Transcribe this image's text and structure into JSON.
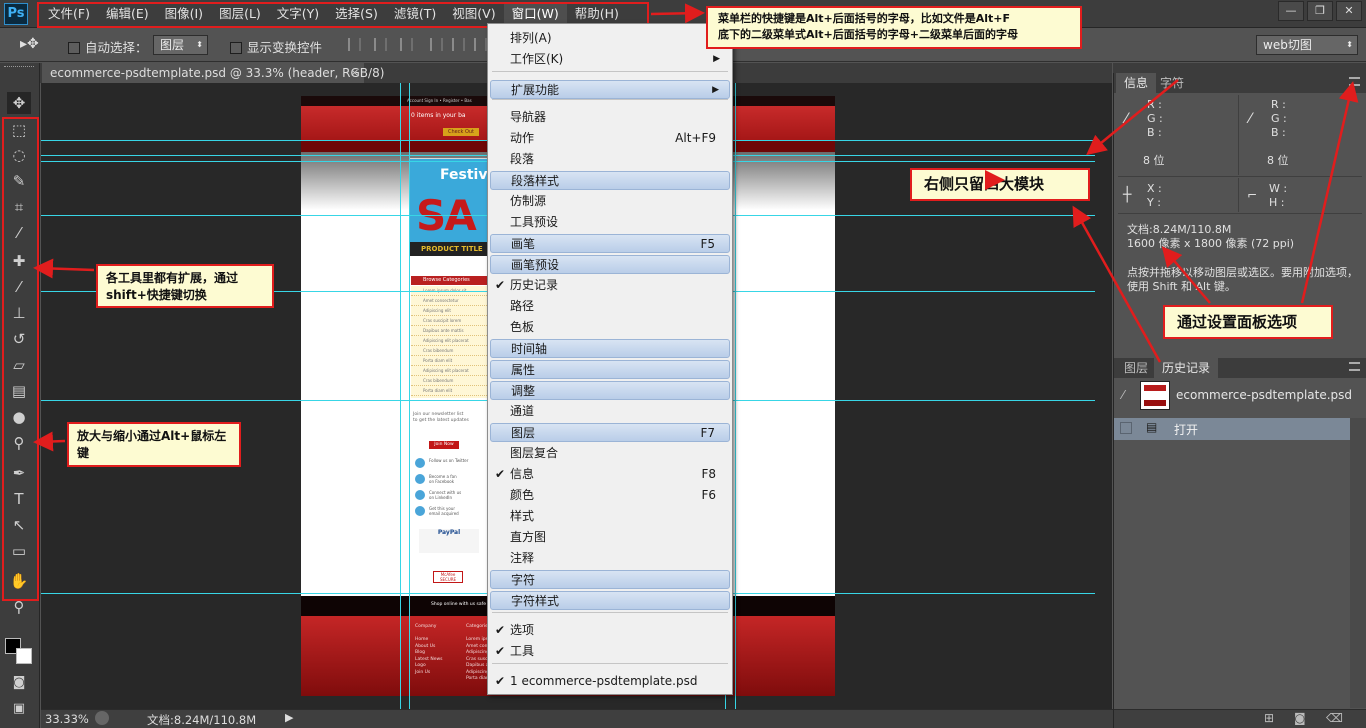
{
  "app": {
    "logo": "Ps"
  },
  "menubar": {
    "items": [
      "文件(F)",
      "编辑(E)",
      "图像(I)",
      "图层(L)",
      "文字(Y)",
      "选择(S)",
      "滤镜(T)",
      "视图(V)",
      "窗口(W)",
      "帮助(H)"
    ],
    "active_index": 8
  },
  "window_controls": [
    "—",
    "❐",
    "✕"
  ],
  "options": {
    "auto_select_label": "自动选择：",
    "auto_select_value": "图层",
    "show_transform_label": "显示变换控件",
    "workspace_value": "web切图"
  },
  "doc_tab": {
    "title": "ecommerce-psdtemplate.psd @ 33.3% (header, RGB/8)",
    "close": "×"
  },
  "window_menu": {
    "items": [
      {
        "label": "排列(A)",
        "arrow": true,
        "hl": false
      },
      {
        "label": "工作区(K)",
        "arrow": true,
        "hl": false
      },
      {
        "sep": true
      },
      {
        "label": "扩展功能",
        "arrow": true,
        "hl": true
      },
      {
        "sep": true
      },
      {
        "label": "导航器"
      },
      {
        "label": "动作",
        "shortcut": "Alt+F9"
      },
      {
        "label": "段落"
      },
      {
        "label": "段落样式",
        "hl": true
      },
      {
        "label": "仿制源"
      },
      {
        "label": "工具预设"
      },
      {
        "label": "画笔",
        "shortcut": "F5",
        "hl": true
      },
      {
        "label": "画笔预设",
        "hl": true
      },
      {
        "label": "历史记录",
        "checked": true
      },
      {
        "label": "路径"
      },
      {
        "label": "色板"
      },
      {
        "label": "时间轴",
        "hl": true
      },
      {
        "label": "属性",
        "hl": true
      },
      {
        "label": "调整",
        "hl": true
      },
      {
        "label": "通道"
      },
      {
        "label": "图层",
        "shortcut": "F7",
        "hl": true
      },
      {
        "label": "图层复合"
      },
      {
        "label": "信息",
        "shortcut": "F8",
        "checked": true
      },
      {
        "label": "颜色",
        "shortcut": "F6"
      },
      {
        "label": "样式"
      },
      {
        "label": "直方图"
      },
      {
        "label": "注释"
      },
      {
        "label": "字符",
        "hl": true
      },
      {
        "label": "字符样式",
        "hl": true
      },
      {
        "sep": true
      },
      {
        "label": "选项",
        "checked": true
      },
      {
        "label": "工具",
        "checked": true
      },
      {
        "sep": true
      },
      {
        "label": "1 ecommerce-psdtemplate.psd",
        "checked": true
      }
    ]
  },
  "info_panel": {
    "tabs": [
      "信息",
      "字符"
    ],
    "rgb_labels": "R :\nG :\nB :",
    "bits": "8 位",
    "xy_labels": "X :\nY :",
    "wh_labels": "W :\nH :",
    "doc_size": "文档:8.24M/110.8M",
    "dimensions": "1600 像素 x 1800 像素 (72 ppi)",
    "hint": "点按并拖移以移动图层或选区。要用附加选项，使用 Shift 和 Alt 键。"
  },
  "history_panel": {
    "tabs": [
      "图层",
      "历史记录"
    ],
    "snapshot_name": "ecommerce-psdtemplate.psd",
    "state": "打开"
  },
  "statusbar": {
    "zoom": "33.33%",
    "doc": "文档:8.24M/110.8M"
  },
  "annotations": {
    "menu_note": "菜单栏的快捷键是Alt+后面括号的字母，比如文件是Alt+F\n底下的二级菜单式Alt+后面括号的字母+二级菜单后面的字母",
    "tools_note": "各工具里都有扩展，通过shift+快捷键切换",
    "zoom_note": "放大与缩小通过Alt+鼠标左键",
    "right_note": "右侧只留四大模块",
    "panel_note": "通过设置面板选项"
  },
  "artboard": {
    "top_links": "Account Sign In  •  Register  •  Bas",
    "cart": "0 items in your ba",
    "checkout": "Check Out",
    "hero_title": "Festiva",
    "hero_big": "SA",
    "product_title": "PRODUCT TITLE",
    "browse": "Browse Categories",
    "categories": [
      "Lorem ipsum dolor sit",
      "Amet consectetur",
      "Adipiscing elit",
      "Cras suscipit lorem",
      "Dapibus ante mattis",
      "Adipiscing elit placerat",
      "Cras bibendum",
      "Porta diam elit",
      "Adipiscing elit placerat",
      "Cras bibendum",
      "Porta diam elit"
    ],
    "newsletter": "Join our newsletter list\nto get the latest updates",
    "join": "Join Now",
    "social": [
      "Follow us on Twitter",
      "Become a fan\non Facebook",
      "Connect with us\non LinkedIn",
      "Get this your\nemail acquired"
    ],
    "paypal": "PayPal",
    "mcafee": "McAfee SECURE",
    "shop_online": "Shop online with us safe",
    "footer_company": "Company\n\nHome\nAbout Us\nBlog\nLatest News\nLogo\nJoin Us",
    "footer_categories": "Categories\n\nLorem ipsum\nAmet conse\nAdipiscing\nCras suscipit\nDapibus ante\nAdipiscing\nPorta diam"
  }
}
